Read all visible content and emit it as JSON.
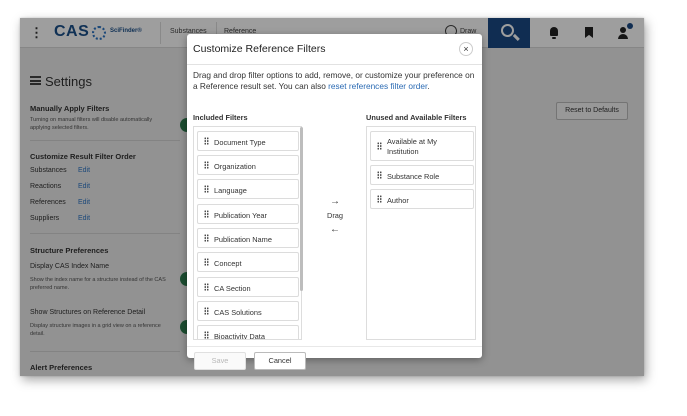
{
  "topbar": {
    "menu_icon": "kebab-icon",
    "logo_text": "CAS",
    "logo_sub": "SciFinder®",
    "tab_1": "Substances",
    "tab_2": "Reference",
    "draw_label": "Draw"
  },
  "settings": {
    "title": "Settings",
    "manual_heading": "Manually Apply Filters",
    "manual_sub": "Turning on manual filters will disable automatically applying selected filters.",
    "order_heading": "Customize Result Filter Order",
    "order_rows": [
      {
        "label": "Substances",
        "edit": "Edit"
      },
      {
        "label": "Reactions",
        "edit": "Edit"
      },
      {
        "label": "References",
        "edit": "Edit"
      },
      {
        "label": "Suppliers",
        "edit": "Edit"
      }
    ],
    "structure_heading": "Structure Preferences",
    "index_name_label": "Display CAS Index Name",
    "index_name_sub": "Show the index name for a structure instead of the CAS preferred name.",
    "show_structures_label": "Show Structures on Reference Detail",
    "show_structures_sub": "Display structure images in a grid view on a reference detail.",
    "alert_heading": "Alert Preferences",
    "reset_label": "Reset to Defaults"
  },
  "modal": {
    "title": "Customize Reference Filters",
    "close_glyph": "×",
    "description_prefix": "Drag and drop filter options to add, remove, or customize your preference on a Reference result set. You can also ",
    "description_link": "reset references filter order",
    "description_suffix": ".",
    "included_label": "Included Filters",
    "unused_label": "Unused and Available Filters",
    "included_filters": [
      "Document Type",
      "Organization",
      "Language",
      "Publication Year",
      "Publication Name",
      "Concept",
      "CA Section",
      "CAS Solutions",
      "Bioactivity Data"
    ],
    "unused_filters": [
      "Available at My Institution",
      "Substance Role",
      "Author"
    ],
    "drag_label": "Drag",
    "right_arrow": "→",
    "left_arrow": "←",
    "save_label": "Save",
    "cancel_label": "Cancel"
  },
  "colors": {
    "brand_navy": "#1a4a85",
    "link_blue": "#2a6ab3",
    "toggle_green": "#2e7d4f"
  }
}
